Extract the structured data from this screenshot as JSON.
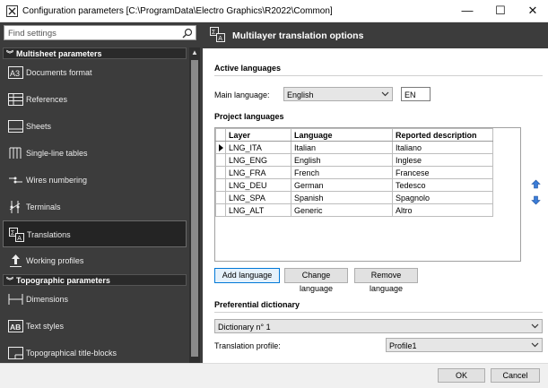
{
  "window": {
    "title": "Configuration parameters [C:\\ProgramData\\Electro Graphics\\R2022\\Common]",
    "minimize": "—",
    "maximize": "☐",
    "close": "✕"
  },
  "sidebar": {
    "search_placeholder": "Find settings",
    "groups": [
      {
        "label": "Multisheet parameters",
        "items": [
          {
            "label": "Documents format",
            "icon": "a3-icon"
          },
          {
            "label": "References",
            "icon": "references-icon"
          },
          {
            "label": "Sheets",
            "icon": "sheets-icon"
          },
          {
            "label": "Single-line tables",
            "icon": "single-line-tables-icon"
          },
          {
            "label": "Wires numbering",
            "icon": "wires-numbering-icon"
          },
          {
            "label": "Terminals",
            "icon": "terminals-icon"
          },
          {
            "label": "Translations",
            "icon": "translations-icon",
            "selected": true
          },
          {
            "label": "Working profiles",
            "icon": "working-profiles-icon"
          }
        ]
      },
      {
        "label": "Topographic parameters",
        "items": [
          {
            "label": "Dimensions",
            "icon": "dimensions-icon"
          },
          {
            "label": "Text styles",
            "icon": "text-styles-icon"
          },
          {
            "label": "Topographical title-blocks",
            "icon": "title-blocks-icon"
          }
        ]
      }
    ]
  },
  "header": {
    "title": "Multilayer translation options"
  },
  "active_languages": {
    "section_title": "Active languages",
    "main_language_label": "Main language:",
    "main_language_value": "English",
    "code_value": "EN"
  },
  "project_languages": {
    "section_title": "Project languages",
    "columns": [
      "Layer",
      "Language",
      "Reported description"
    ],
    "rows": [
      {
        "layer": "LNG_ITA",
        "language": "Italian",
        "description": "Italiano",
        "current": true
      },
      {
        "layer": "LNG_ENG",
        "language": "English",
        "description": "Inglese"
      },
      {
        "layer": "LNG_FRA",
        "language": "French",
        "description": "Francese"
      },
      {
        "layer": "LNG_DEU",
        "language": "German",
        "description": "Tedesco"
      },
      {
        "layer": "LNG_SPA",
        "language": "Spanish",
        "description": "Spagnolo"
      },
      {
        "layer": "LNG_ALT",
        "language": "Generic",
        "description": "Altro"
      }
    ],
    "buttons": {
      "add": "Add language",
      "change": "Change language",
      "remove": "Remove language"
    }
  },
  "preferential_dictionary": {
    "section_title": "Preferential dictionary",
    "dictionary_value": "Dictionary n° 1",
    "translation_profile_label": "Translation profile:",
    "translation_profile_value": "Profile1"
  },
  "footer": {
    "ok": "OK",
    "cancel": "Cancel"
  },
  "colors": {
    "sidebar_bg": "#3c3c3c",
    "accent_blue": "#0078d7",
    "move_arrow_blue": "#3b7dd8"
  }
}
